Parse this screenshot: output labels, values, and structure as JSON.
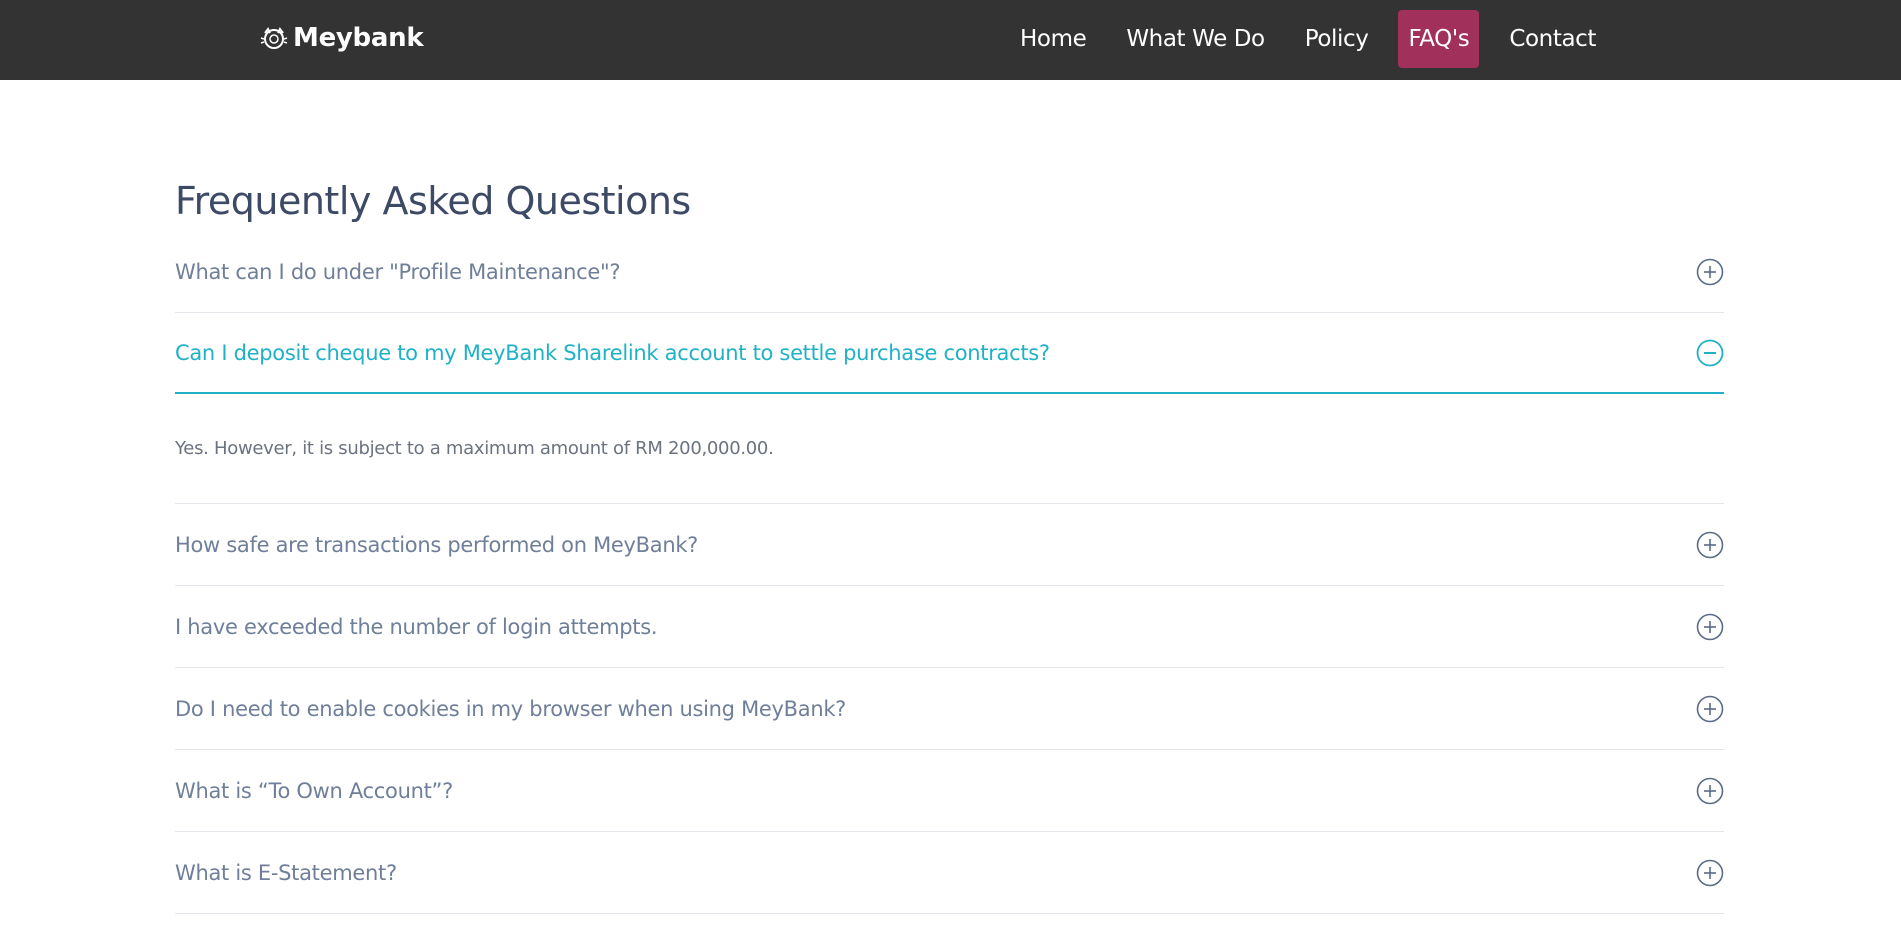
{
  "brand": {
    "name": "Meybank"
  },
  "nav": {
    "items": [
      {
        "label": "Home",
        "active": false
      },
      {
        "label": "What We Do",
        "active": false
      },
      {
        "label": "Policy",
        "active": false
      },
      {
        "label": "FAQ's",
        "active": true
      },
      {
        "label": "Contact",
        "active": false
      }
    ]
  },
  "colors": {
    "navbar_bg": "#333333",
    "active_nav_bg": "#a1305a",
    "accent": "#1fb2c6",
    "title": "#3d4a66",
    "question": "#6f7f99"
  },
  "page": {
    "title": "Frequently Asked Questions"
  },
  "faq": [
    {
      "question": "What can I do under \"Profile Maintenance\"?",
      "open": false,
      "icon": "plus-circle-icon"
    },
    {
      "question": "Can I deposit cheque to my MeyBank Sharelink account to settle purchase contracts?",
      "open": true,
      "icon": "minus-circle-icon",
      "answer": "Yes. However, it is subject to a maximum amount of RM 200,000.00."
    },
    {
      "question": "How safe are transactions performed on MeyBank?",
      "open": false,
      "icon": "plus-circle-icon"
    },
    {
      "question": "I have exceeded the number of login attempts.",
      "open": false,
      "icon": "plus-circle-icon"
    },
    {
      "question": "Do I need to enable cookies in my browser when using MeyBank?",
      "open": false,
      "icon": "plus-circle-icon"
    },
    {
      "question": "What is “To Own Account”?",
      "open": false,
      "icon": "plus-circle-icon"
    },
    {
      "question": "What is E-Statement?",
      "open": false,
      "icon": "plus-circle-icon"
    }
  ]
}
